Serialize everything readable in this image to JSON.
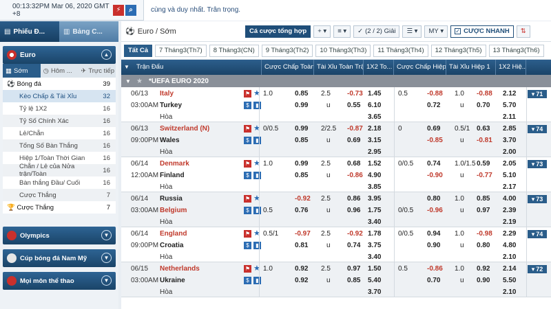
{
  "topbar": {
    "clock": "00:13:32PM Mar 06, 2020 GMT +8",
    "marquee": "cùng và duy nhất. Trân trọng."
  },
  "sidebar": {
    "tab_bet": "Phiếu Đ...",
    "tab_table": "Bảng C...",
    "section": "Euro",
    "subtabs": [
      "Sớm",
      "Hôm ...",
      "Trực tiếp"
    ],
    "items": [
      {
        "label": "Bóng đá",
        "count": "39"
      },
      {
        "label": "Kèo Chấp & Tài Xỉu",
        "count": "32"
      },
      {
        "label": "Tỷ lệ 1X2",
        "count": "16"
      },
      {
        "label": "Tỷ Số Chính Xác",
        "count": "16"
      },
      {
        "label": "Lẻ/Chẵn",
        "count": "16"
      },
      {
        "label": "Tổng Số Bàn Thắng",
        "count": "16"
      },
      {
        "label": "Hiệp 1/Toàn Thời Gian",
        "count": "16"
      },
      {
        "label": "Chẵn / Lẻ của Nửa trận/Toàn",
        "count": "16"
      },
      {
        "label": "Bàn thắng Đầu/ Cuối",
        "count": "16"
      },
      {
        "label": "Cược Thắng",
        "count": "7"
      },
      {
        "label": "Cược Thắng",
        "count": "7"
      }
    ],
    "bottom": [
      "Olympics",
      "Cúp bóng đá Nam Mỹ",
      "Mọi môn thể thao"
    ]
  },
  "toolbar": {
    "breadcrumb": "Euro / Sớm",
    "all_bets": "Cá cược tổng hợp",
    "plus": "+",
    "sort": "≡",
    "leagues": "(2 / 2) Giải",
    "view": "☰",
    "odds_type": "MY",
    "quick_bet": "CƯỢC NHANH"
  },
  "daytabs": [
    "Tất Cả",
    "7 Tháng3(Th7)",
    "8 Tháng3(CN)",
    "9 Tháng3(Th2)",
    "10 Tháng3(Th3)",
    "11 Tháng3(Th4)",
    "12 Tháng3(Th5)",
    "13 Tháng3(Th6)"
  ],
  "headers": [
    "Trận Đấu",
    "Cược Chấp Toàn...",
    "Tài Xỉu Toàn Trận",
    "1X2 To...",
    "Cược Chấp Hiệp 1",
    "Tài Xỉu Hiệp 1",
    "1X2 Hiệ..."
  ],
  "league": "*UEFA EURO 2020",
  "matches": [
    {
      "date": "06/13",
      "time": "03:00AM",
      "home": "Italy",
      "away": "Turkey",
      "draw": "Hòa",
      "fav": "home",
      "hcp_line_home": "1.0",
      "hcp_line_away": "",
      "hcp_home": "0.85",
      "hcp_away": "0.99",
      "ou_line": "2.5",
      "ou_over": "-0.73",
      "ou_u": "u",
      "ou_under": "0.55",
      "x1": "1.45",
      "x2": "6.10",
      "xd": "3.65",
      "h1_line_home": "0.5",
      "h1_line_away": "",
      "h1_home": "-0.88",
      "h1_away": "0.72",
      "h1ou_line": "1.0",
      "h1ou_over": "-0.88",
      "h1ou_u": "u",
      "h1ou_under": "0.70",
      "h1x1": "2.12",
      "h1x2": "5.70",
      "h1xd": "2.11",
      "more": "71"
    },
    {
      "date": "06/13",
      "time": "09:00PM",
      "home": "Switzerland (N)",
      "away": "Wales",
      "draw": "Hòa",
      "fav": "home",
      "hcp_line_home": "0/0.5",
      "hcp_line_away": "",
      "hcp_home": "0.99",
      "hcp_away": "0.85",
      "ou_line": "2/2.5",
      "ou_over": "-0.87",
      "ou_u": "u",
      "ou_under": "0.69",
      "x1": "2.18",
      "x2": "3.15",
      "xd": "2.95",
      "h1_line_home": "0",
      "h1_line_away": "",
      "h1_home": "0.69",
      "h1_away": "-0.85",
      "h1ou_line": "0.5/1",
      "h1ou_over": "0.63",
      "h1ou_u": "u",
      "h1ou_under": "-0.81",
      "h1x1": "2.85",
      "h1x2": "3.70",
      "h1xd": "2.00",
      "more": "74"
    },
    {
      "date": "06/14",
      "time": "12:00AM",
      "home": "Denmark",
      "away": "Finland",
      "draw": "Hòa",
      "fav": "home",
      "hcp_line_home": "1.0",
      "hcp_line_away": "",
      "hcp_home": "0.99",
      "hcp_away": "0.85",
      "ou_line": "2.5",
      "ou_over": "0.68",
      "ou_u": "u",
      "ou_under": "-0.86",
      "x1": "1.52",
      "x2": "4.90",
      "xd": "3.85",
      "h1_line_home": "0/0.5",
      "h1_line_away": "",
      "h1_home": "0.74",
      "h1_away": "-0.90",
      "h1ou_line": "1.0/1.5",
      "h1ou_over": "0.59",
      "h1ou_u": "u",
      "h1ou_under": "-0.77",
      "h1x1": "2.05",
      "h1x2": "5.10",
      "h1xd": "2.17",
      "more": "73"
    },
    {
      "date": "06/14",
      "time": "03:00AM",
      "home": "Russia",
      "away": "Belgium",
      "draw": "Hòa",
      "fav": "away",
      "hcp_line_home": "",
      "hcp_line_away": "0.5",
      "hcp_home": "-0.92",
      "hcp_away": "0.76",
      "ou_line": "2.5",
      "ou_over": "0.86",
      "ou_u": "u",
      "ou_under": "0.96",
      "x1": "3.95",
      "x2": "1.75",
      "xd": "3.40",
      "h1_line_home": "",
      "h1_line_away": "0/0.5",
      "h1_home": "0.80",
      "h1_away": "-0.96",
      "h1ou_line": "1.0",
      "h1ou_over": "0.85",
      "h1ou_u": "u",
      "h1ou_under": "0.97",
      "h1x1": "4.00",
      "h1x2": "2.39",
      "h1xd": "2.19",
      "more": "73"
    },
    {
      "date": "06/14",
      "time": "09:00PM",
      "home": "England",
      "away": "Croatia",
      "draw": "Hòa",
      "fav": "home",
      "hcp_line_home": "0.5/1",
      "hcp_line_away": "",
      "hcp_home": "-0.97",
      "hcp_away": "0.81",
      "ou_line": "2.5",
      "ou_over": "-0.92",
      "ou_u": "u",
      "ou_under": "0.74",
      "x1": "1.78",
      "x2": "3.75",
      "xd": "3.40",
      "h1_line_home": "0/0.5",
      "h1_line_away": "",
      "h1_home": "0.94",
      "h1_away": "0.90",
      "h1ou_line": "1.0",
      "h1ou_over": "-0.98",
      "h1ou_u": "u",
      "h1ou_under": "0.80",
      "h1x1": "2.29",
      "h1x2": "4.80",
      "h1xd": "2.10",
      "more": "74"
    },
    {
      "date": "06/15",
      "time": "03:00AM",
      "home": "Netherlands",
      "away": "Ukraine",
      "draw": "Hòa",
      "fav": "home",
      "hcp_line_home": "1.0",
      "hcp_line_away": "",
      "hcp_home": "0.92",
      "hcp_away": "0.92",
      "ou_line": "2.5",
      "ou_over": "0.97",
      "ou_u": "u",
      "ou_under": "0.85",
      "x1": "1.50",
      "x2": "5.40",
      "xd": "3.70",
      "h1_line_home": "0.5",
      "h1_line_away": "",
      "h1_home": "-0.86",
      "h1_away": "0.70",
      "h1ou_line": "1.0",
      "h1ou_over": "0.92",
      "h1ou_u": "u",
      "h1ou_under": "0.90",
      "h1x1": "2.14",
      "h1x2": "5.50",
      "h1xd": "2.10",
      "more": "72"
    }
  ]
}
